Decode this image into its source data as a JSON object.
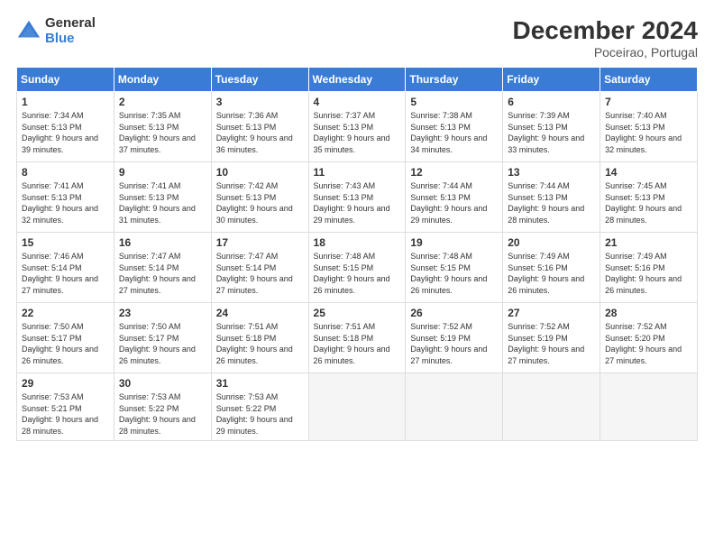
{
  "header": {
    "logo_general": "General",
    "logo_blue": "Blue",
    "title": "December 2024",
    "location": "Poceirao, Portugal"
  },
  "weekdays": [
    "Sunday",
    "Monday",
    "Tuesday",
    "Wednesday",
    "Thursday",
    "Friday",
    "Saturday"
  ],
  "weeks": [
    [
      {
        "day": "1",
        "sunrise": "7:34 AM",
        "sunset": "5:13 PM",
        "daylight": "9 hours and 39 minutes."
      },
      {
        "day": "2",
        "sunrise": "7:35 AM",
        "sunset": "5:13 PM",
        "daylight": "9 hours and 37 minutes."
      },
      {
        "day": "3",
        "sunrise": "7:36 AM",
        "sunset": "5:13 PM",
        "daylight": "9 hours and 36 minutes."
      },
      {
        "day": "4",
        "sunrise": "7:37 AM",
        "sunset": "5:13 PM",
        "daylight": "9 hours and 35 minutes."
      },
      {
        "day": "5",
        "sunrise": "7:38 AM",
        "sunset": "5:13 PM",
        "daylight": "9 hours and 34 minutes."
      },
      {
        "day": "6",
        "sunrise": "7:39 AM",
        "sunset": "5:13 PM",
        "daylight": "9 hours and 33 minutes."
      },
      {
        "day": "7",
        "sunrise": "7:40 AM",
        "sunset": "5:13 PM",
        "daylight": "9 hours and 32 minutes."
      }
    ],
    [
      {
        "day": "8",
        "sunrise": "7:41 AM",
        "sunset": "5:13 PM",
        "daylight": "9 hours and 32 minutes."
      },
      {
        "day": "9",
        "sunrise": "7:41 AM",
        "sunset": "5:13 PM",
        "daylight": "9 hours and 31 minutes."
      },
      {
        "day": "10",
        "sunrise": "7:42 AM",
        "sunset": "5:13 PM",
        "daylight": "9 hours and 30 minutes."
      },
      {
        "day": "11",
        "sunrise": "7:43 AM",
        "sunset": "5:13 PM",
        "daylight": "9 hours and 29 minutes."
      },
      {
        "day": "12",
        "sunrise": "7:44 AM",
        "sunset": "5:13 PM",
        "daylight": "9 hours and 29 minutes."
      },
      {
        "day": "13",
        "sunrise": "7:44 AM",
        "sunset": "5:13 PM",
        "daylight": "9 hours and 28 minutes."
      },
      {
        "day": "14",
        "sunrise": "7:45 AM",
        "sunset": "5:13 PM",
        "daylight": "9 hours and 28 minutes."
      }
    ],
    [
      {
        "day": "15",
        "sunrise": "7:46 AM",
        "sunset": "5:14 PM",
        "daylight": "9 hours and 27 minutes."
      },
      {
        "day": "16",
        "sunrise": "7:47 AM",
        "sunset": "5:14 PM",
        "daylight": "9 hours and 27 minutes."
      },
      {
        "day": "17",
        "sunrise": "7:47 AM",
        "sunset": "5:14 PM",
        "daylight": "9 hours and 27 minutes."
      },
      {
        "day": "18",
        "sunrise": "7:48 AM",
        "sunset": "5:15 PM",
        "daylight": "9 hours and 26 minutes."
      },
      {
        "day": "19",
        "sunrise": "7:48 AM",
        "sunset": "5:15 PM",
        "daylight": "9 hours and 26 minutes."
      },
      {
        "day": "20",
        "sunrise": "7:49 AM",
        "sunset": "5:16 PM",
        "daylight": "9 hours and 26 minutes."
      },
      {
        "day": "21",
        "sunrise": "7:49 AM",
        "sunset": "5:16 PM",
        "daylight": "9 hours and 26 minutes."
      }
    ],
    [
      {
        "day": "22",
        "sunrise": "7:50 AM",
        "sunset": "5:17 PM",
        "daylight": "9 hours and 26 minutes."
      },
      {
        "day": "23",
        "sunrise": "7:50 AM",
        "sunset": "5:17 PM",
        "daylight": "9 hours and 26 minutes."
      },
      {
        "day": "24",
        "sunrise": "7:51 AM",
        "sunset": "5:18 PM",
        "daylight": "9 hours and 26 minutes."
      },
      {
        "day": "25",
        "sunrise": "7:51 AM",
        "sunset": "5:18 PM",
        "daylight": "9 hours and 26 minutes."
      },
      {
        "day": "26",
        "sunrise": "7:52 AM",
        "sunset": "5:19 PM",
        "daylight": "9 hours and 27 minutes."
      },
      {
        "day": "27",
        "sunrise": "7:52 AM",
        "sunset": "5:19 PM",
        "daylight": "9 hours and 27 minutes."
      },
      {
        "day": "28",
        "sunrise": "7:52 AM",
        "sunset": "5:20 PM",
        "daylight": "9 hours and 27 minutes."
      }
    ],
    [
      {
        "day": "29",
        "sunrise": "7:53 AM",
        "sunset": "5:21 PM",
        "daylight": "9 hours and 28 minutes."
      },
      {
        "day": "30",
        "sunrise": "7:53 AM",
        "sunset": "5:22 PM",
        "daylight": "9 hours and 28 minutes."
      },
      {
        "day": "31",
        "sunrise": "7:53 AM",
        "sunset": "5:22 PM",
        "daylight": "9 hours and 29 minutes."
      },
      null,
      null,
      null,
      null
    ]
  ]
}
